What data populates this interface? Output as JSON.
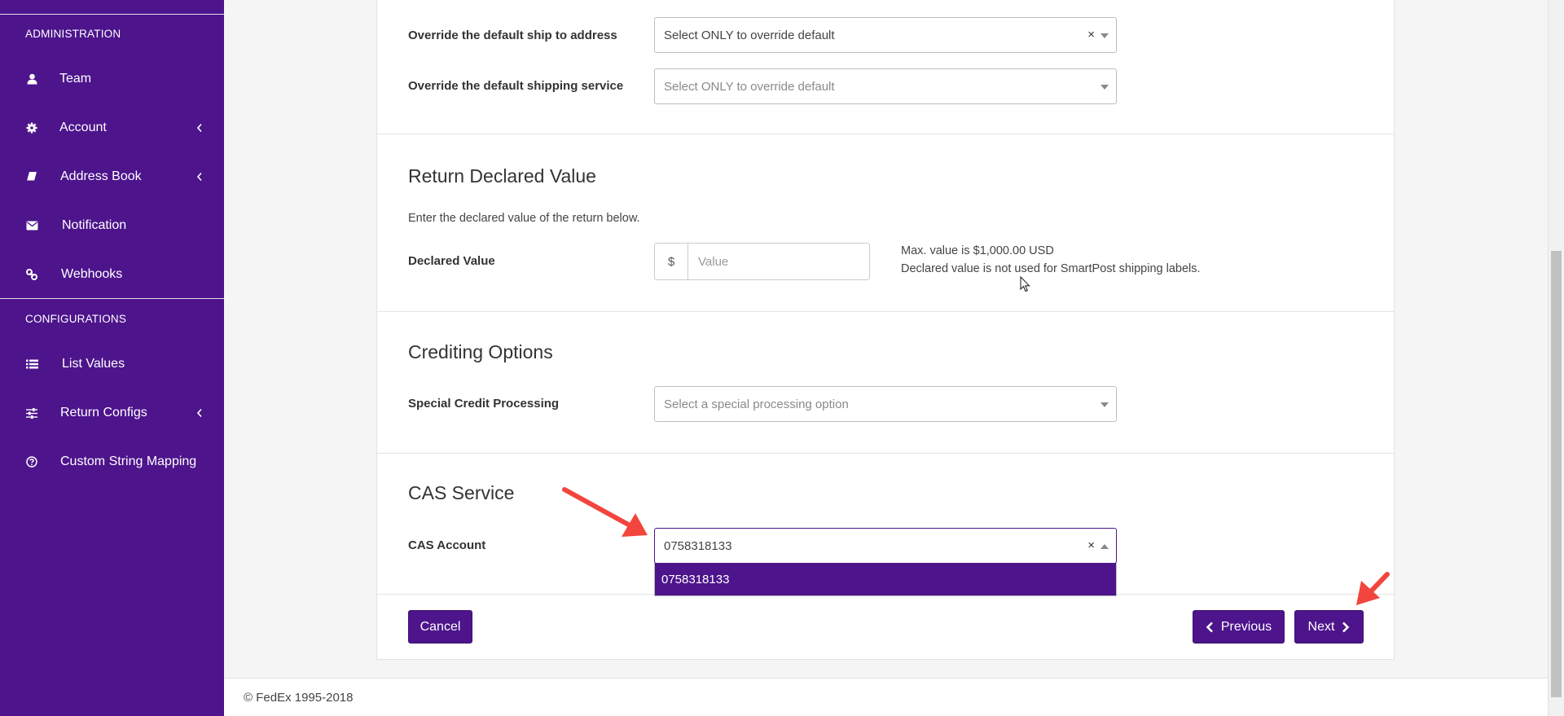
{
  "sidebar": {
    "background": "#4d148c",
    "sections": [
      {
        "heading": "ADMINISTRATION"
      },
      {
        "heading": "CONFIGURATIONS"
      }
    ],
    "items": [
      {
        "label": "Team",
        "icon": "user-icon"
      },
      {
        "label": "Account",
        "icon": "gear-icon",
        "has_submenu": true
      },
      {
        "label": "Address Book",
        "icon": "book-icon",
        "has_submenu": true
      },
      {
        "label": "Notification",
        "icon": "envelope-icon"
      },
      {
        "label": "Webhooks",
        "icon": "link-icon"
      },
      {
        "label": "List Values",
        "icon": "list-icon"
      },
      {
        "label": "Return Configs",
        "icon": "sliders-icon",
        "has_submenu": true
      },
      {
        "label": "Custom String Mapping",
        "icon": "question-circle-icon"
      }
    ]
  },
  "form": {
    "ship_to": {
      "label": "Override the default ship to address",
      "value": "Select ONLY to override default",
      "clear": "×"
    },
    "shipping_service": {
      "label": "Override the default shipping service",
      "placeholder": "Select ONLY to override default"
    },
    "declared": {
      "title": "Return Declared Value",
      "intro": "Enter the declared value of the return below.",
      "label": "Declared Value",
      "currency": "$",
      "placeholder": "Value",
      "note_max": "Max. value is $1,000.00 USD",
      "note_smartpost": "Declared value is not used for SmartPost shipping labels."
    },
    "crediting": {
      "title": "Crediting Options",
      "label": "Special Credit Processing",
      "placeholder": "Select a special processing option"
    },
    "cas": {
      "title": "CAS Service",
      "label": "CAS Account",
      "value": "0758318133",
      "clear": "×",
      "options": [
        "0758318133"
      ]
    }
  },
  "buttons": {
    "cancel": "Cancel",
    "previous": "Previous",
    "next": "Next"
  },
  "footer": {
    "text": "© FedEx 1995-2018"
  },
  "colors": {
    "accent": "#4d148c",
    "annotation_arrow": "#f2453d"
  }
}
